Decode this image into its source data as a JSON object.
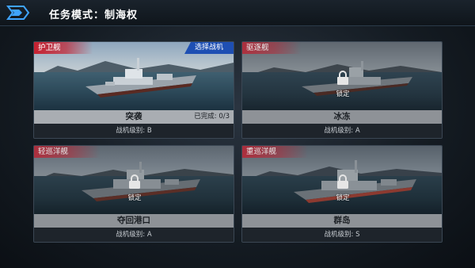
{
  "header": {
    "title": "任务模式：制海权"
  },
  "cards": [
    {
      "ship_class": "护卫舰",
      "select_label": "选择战机",
      "name": "突袭",
      "progress": "已完成: 0/3",
      "rank": "战机级别: B",
      "locked": false
    },
    {
      "ship_class": "驱逐舰",
      "name": "冰冻",
      "rank": "战机级别: A",
      "lock_label": "锁定",
      "locked": true
    },
    {
      "ship_class": "轻巡洋舰",
      "name": "夺回港口",
      "rank": "战机级别: A",
      "lock_label": "锁定",
      "locked": true
    },
    {
      "ship_class": "重巡洋舰",
      "name": "群岛",
      "rank": "战机级别: S",
      "lock_label": "锁定",
      "locked": true
    }
  ],
  "colors": {
    "accent_blue": "#1e4fb3",
    "class_tag_red": "#c81928",
    "name_bar": "#a9adb2"
  }
}
